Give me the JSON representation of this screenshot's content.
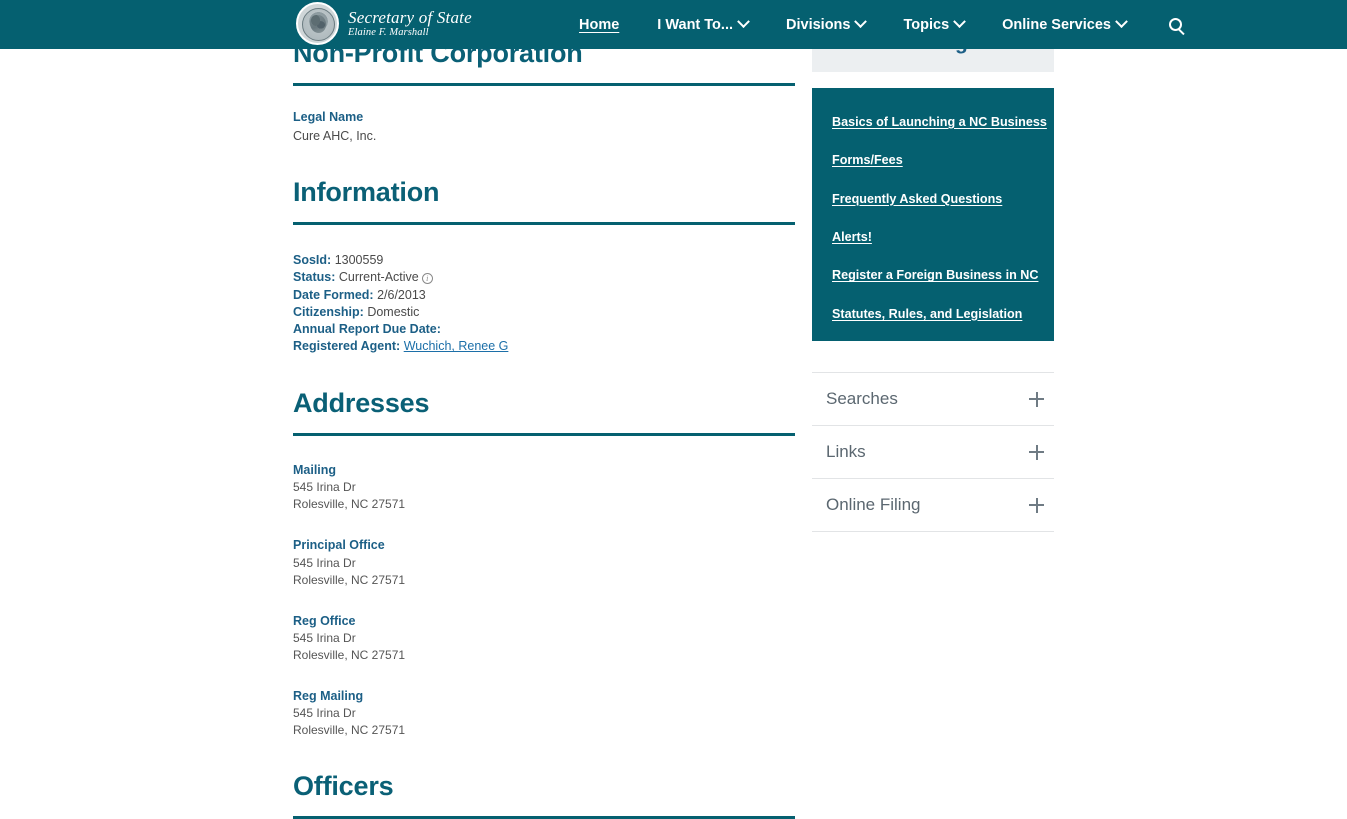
{
  "header": {
    "brand": {
      "line1": "Secretary of State",
      "line2": "Elaine F. Marshall",
      "seal_icon": "state-seal-icon"
    },
    "nav": [
      {
        "label": "Home",
        "active": true,
        "has_caret": false
      },
      {
        "label": "I Want To...",
        "active": false,
        "has_caret": true
      },
      {
        "label": "Divisions",
        "active": false,
        "has_caret": true
      },
      {
        "label": "Topics",
        "active": false,
        "has_caret": true
      },
      {
        "label": "Online Services",
        "active": false,
        "has_caret": true
      }
    ],
    "search_icon": "search-icon"
  },
  "main": {
    "page_title": "Non-Profit Corporation",
    "legal_name_label": "Legal Name",
    "legal_name_value": "Cure AHC, Inc.",
    "information_title": "Information",
    "information": [
      {
        "key": "SosId:",
        "value": "1300559",
        "info_icon": false
      },
      {
        "key": "Status:",
        "value": "Current-Active",
        "info_icon": true
      },
      {
        "key": "Date Formed:",
        "value": "2/6/2013",
        "info_icon": false
      },
      {
        "key": "Citizenship:",
        "value": "Domestic",
        "info_icon": false
      },
      {
        "key": "Annual Report Due Date:",
        "value": "",
        "info_icon": false
      }
    ],
    "registered_agent_label": "Registered Agent:",
    "registered_agent_value": "Wuchich, Renee G",
    "addresses_title": "Addresses",
    "addresses": [
      {
        "type": "Mailing",
        "street": "545 Irina Dr",
        "citystatezip": "Rolesville,  NC  27571"
      },
      {
        "type": "Principal Office",
        "street": "545 Irina Dr",
        "citystatezip": "Rolesville,  NC  27571"
      },
      {
        "type": "Reg Office",
        "street": "545 Irina Dr",
        "citystatezip": "Rolesville,  NC  27571"
      },
      {
        "type": "Reg Mailing",
        "street": "545 Irina Dr",
        "citystatezip": "Rolesville,  NC  27571"
      }
    ],
    "officers_title": "Officers"
  },
  "sidebar": {
    "section_heading": "Business Registration",
    "links": [
      "Basics of Launching a NC Business",
      "Forms/Fees",
      "Frequently Asked Questions",
      "Alerts!",
      "Register a Foreign Business in NC",
      "Statutes, Rules, and Legislation"
    ],
    "accordion": [
      {
        "label": "Searches",
        "icon": "plus-icon"
      },
      {
        "label": "Links",
        "icon": "plus-icon"
      },
      {
        "label": "Online Filing",
        "icon": "plus-icon"
      }
    ]
  },
  "colors": {
    "brand_teal": "#056070",
    "heading_blue": "#0a6076",
    "label_blue": "#1c5f86",
    "link_blue": "#1c6fa8",
    "body_gray": "#4a4a4a",
    "panel_gray": "#eceff1"
  }
}
